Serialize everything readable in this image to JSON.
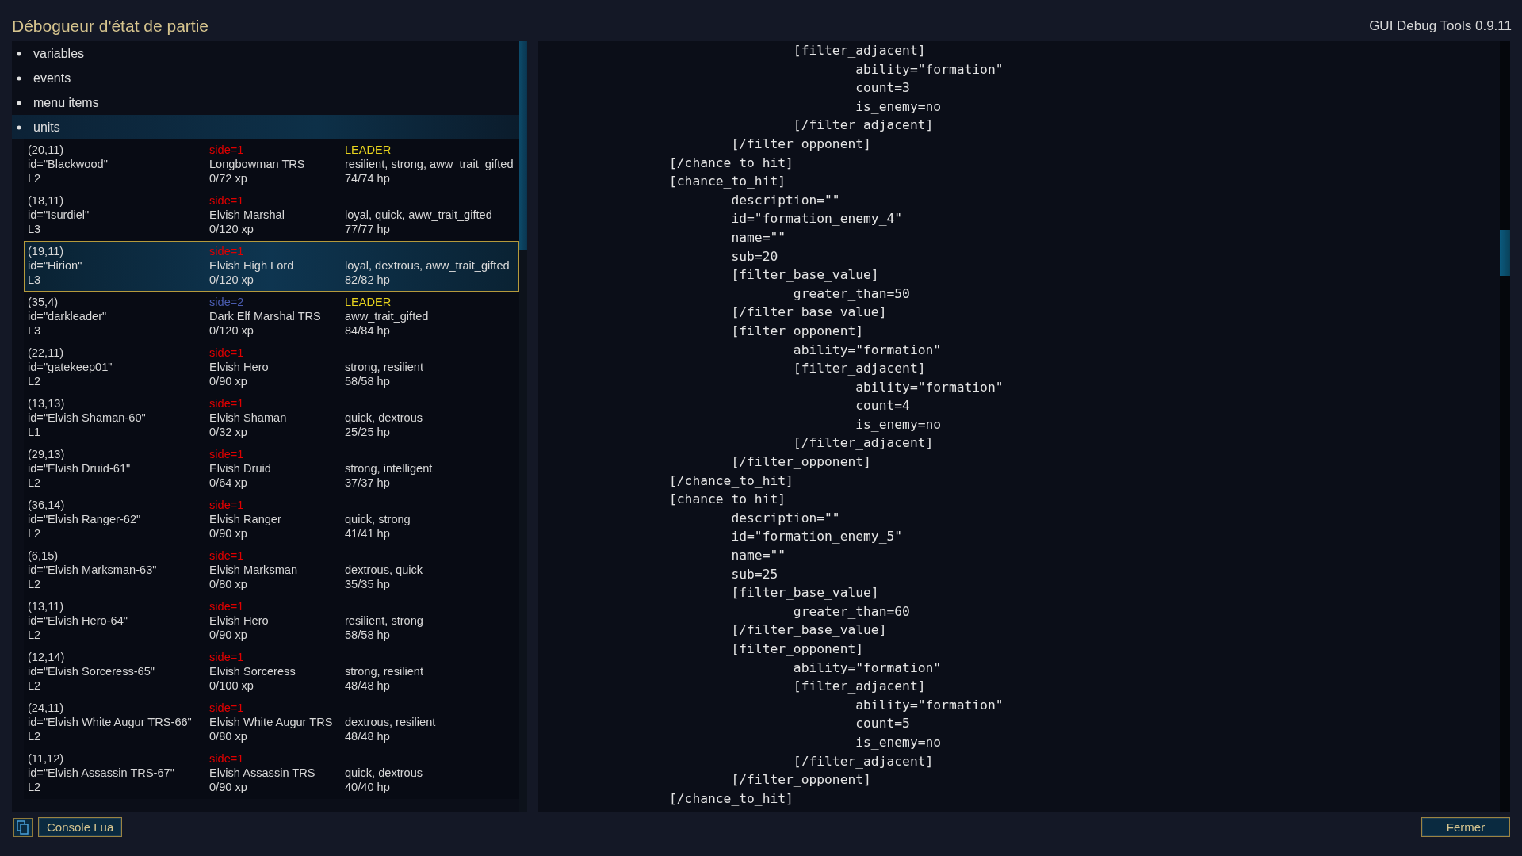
{
  "window": {
    "title": "Débogueur d'état de partie",
    "version": "GUI Debug Tools 0.9.11"
  },
  "tree": [
    {
      "label": "variables",
      "selected": false
    },
    {
      "label": "events",
      "selected": false
    },
    {
      "label": "menu items",
      "selected": false
    },
    {
      "label": "units",
      "selected": true
    }
  ],
  "units": [
    {
      "coords": "(20,11)",
      "id": "id=\"Blackwood\"",
      "level": "L2",
      "side": "side=1",
      "color": "#e00000",
      "type": "Longbowman TRS",
      "xp": "0/72 xp",
      "leader": "LEADER",
      "traits": "resilient, strong, aww_trait_gifted",
      "hp": "74/74 hp",
      "selected": false
    },
    {
      "coords": "(18,11)",
      "id": "id=\"Isurdiel\"",
      "level": "L3",
      "side": "side=1",
      "color": "#e00000",
      "type": "Elvish Marshal",
      "xp": "0/120 xp",
      "traits": "loyal, quick, aww_trait_gifted",
      "hp": "77/77 hp",
      "selected": false
    },
    {
      "coords": "(19,11)",
      "id": "id=\"Hirion\"",
      "level": "L3",
      "side": "side=1",
      "color": "#e00000",
      "type": "Elvish High Lord",
      "xp": "0/120 xp",
      "traits": "loyal, dextrous, aww_trait_gifted",
      "hp": "82/82 hp",
      "selected": true
    },
    {
      "coords": "(35,4)",
      "id": "id=\"darkleader\"",
      "level": "L3",
      "side": "side=2",
      "color": "#4a5cb0",
      "type": "Dark Elf Marshal TRS",
      "xp": "0/120 xp",
      "leader": "LEADER",
      "traits": "aww_trait_gifted",
      "hp": "84/84 hp",
      "selected": false
    },
    {
      "coords": "(22,11)",
      "id": "id=\"gatekeep01\"",
      "level": "L2",
      "side": "side=1",
      "color": "#e00000",
      "type": "Elvish Hero",
      "xp": "0/90 xp",
      "traits": "strong, resilient",
      "hp": "58/58 hp",
      "selected": false
    },
    {
      "coords": "(13,13)",
      "id": "id=\"Elvish Shaman-60\"",
      "level": "L1",
      "side": "side=1",
      "color": "#e00000",
      "type": "Elvish Shaman",
      "xp": "0/32 xp",
      "traits": "quick, dextrous",
      "hp": "25/25 hp",
      "selected": false
    },
    {
      "coords": "(29,13)",
      "id": "id=\"Elvish Druid-61\"",
      "level": "L2",
      "side": "side=1",
      "color": "#e00000",
      "type": "Elvish Druid",
      "xp": "0/64 xp",
      "traits": "strong, intelligent",
      "hp": "37/37 hp",
      "selected": false
    },
    {
      "coords": "(36,14)",
      "id": "id=\"Elvish Ranger-62\"",
      "level": "L2",
      "side": "side=1",
      "color": "#e00000",
      "type": "Elvish Ranger",
      "xp": "0/90 xp",
      "traits": "quick, strong",
      "hp": "41/41 hp",
      "selected": false
    },
    {
      "coords": "(6,15)",
      "id": "id=\"Elvish Marksman-63\"",
      "level": "L2",
      "side": "side=1",
      "color": "#e00000",
      "type": "Elvish Marksman",
      "xp": "0/80 xp",
      "traits": "dextrous, quick",
      "hp": "35/35 hp",
      "selected": false
    },
    {
      "coords": "(13,11)",
      "id": "id=\"Elvish Hero-64\"",
      "level": "L2",
      "side": "side=1",
      "color": "#e00000",
      "type": "Elvish Hero",
      "xp": "0/90 xp",
      "traits": "resilient, strong",
      "hp": "58/58 hp",
      "selected": false
    },
    {
      "coords": "(12,14)",
      "id": "id=\"Elvish Sorceress-65\"",
      "level": "L2",
      "side": "side=1",
      "color": "#e00000",
      "type": "Elvish Sorceress",
      "xp": "0/100 xp",
      "traits": "strong, resilient",
      "hp": "48/48 hp",
      "selected": false
    },
    {
      "coords": "(24,11)",
      "id": "id=\"Elvish White Augur TRS-66\"",
      "level": "L2",
      "side": "side=1",
      "color": "#e00000",
      "type": "Elvish White Augur TRS",
      "xp": "0/80 xp",
      "traits": "dextrous, resilient",
      "hp": "48/48 hp",
      "selected": false
    },
    {
      "coords": "(11,12)",
      "id": "id=\"Elvish Assassin TRS-67\"",
      "level": "L2",
      "side": "side=1",
      "color": "#e00000",
      "type": "Elvish Assassin TRS",
      "xp": "0/90 xp",
      "traits": "quick, dextrous",
      "hp": "40/40 hp",
      "selected": false
    }
  ],
  "code": [
    "\t\t[filter_adjacent]",
    "\t\t\tability=\"formation\"",
    "\t\t\tcount=3",
    "\t\t\tis_enemy=no",
    "\t\t[/filter_adjacent]",
    "\t[/filter_opponent]",
    "[/chance_to_hit]",
    "[chance_to_hit]",
    "\tdescription=\"\"",
    "\tid=\"formation_enemy_4\"",
    "\tname=\"\"",
    "\tsub=20",
    "\t[filter_base_value]",
    "\t\tgreater_than=50",
    "\t[/filter_base_value]",
    "\t[filter_opponent]",
    "\t\tability=\"formation\"",
    "\t\t[filter_adjacent]",
    "\t\t\tability=\"formation\"",
    "\t\t\tcount=4",
    "\t\t\tis_enemy=no",
    "\t\t[/filter_adjacent]",
    "\t[/filter_opponent]",
    "[/chance_to_hit]",
    "[chance_to_hit]",
    "\tdescription=\"\"",
    "\tid=\"formation_enemy_5\"",
    "\tname=\"\"",
    "\tsub=25",
    "\t[filter_base_value]",
    "\t\tgreater_than=60",
    "\t[/filter_base_value]",
    "\t[filter_opponent]",
    "\t\tability=\"formation\"",
    "\t\t[filter_adjacent]",
    "\t\t\tability=\"formation\"",
    "\t\t\tcount=5",
    "\t\t\tis_enemy=no",
    "\t\t[/filter_adjacent]",
    "\t[/filter_opponent]",
    "[/chance_to_hit]"
  ],
  "buttons": {
    "console": "Console Lua",
    "close": "Fermer"
  }
}
